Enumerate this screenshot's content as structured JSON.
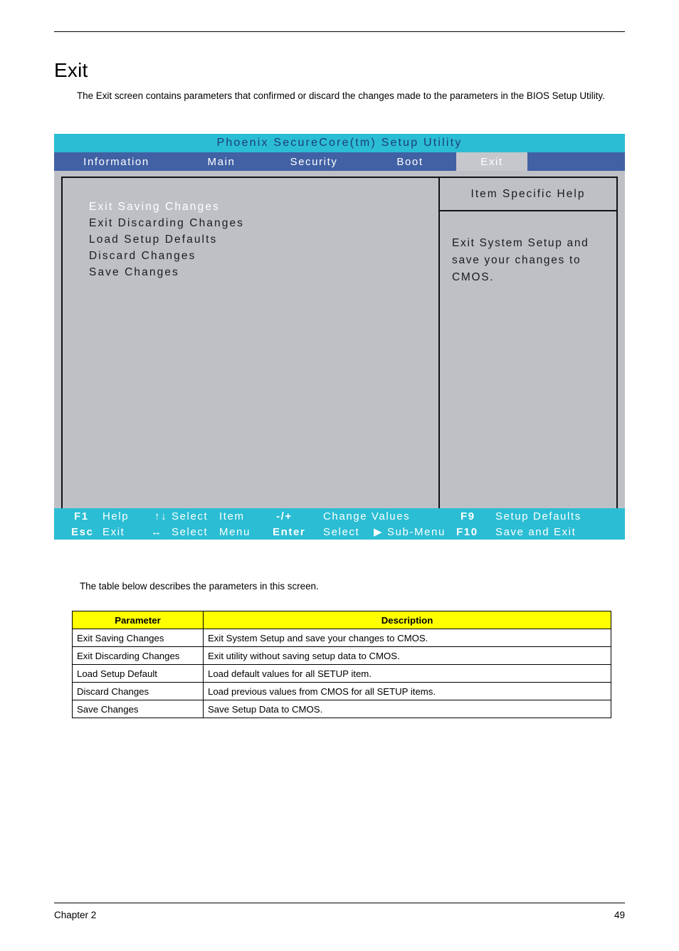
{
  "document": {
    "title": "Exit",
    "intro": "The Exit screen contains parameters that confirmed or discard the changes made to the parameters in the BIOS Setup Utility.",
    "table_lead": "The table below describes the parameters in this screen.",
    "footer_chapter": "Chapter 2",
    "footer_page": "49"
  },
  "bios": {
    "title": "Phoenix SecureCore(tm) Setup Utility",
    "tabs": [
      {
        "label": "Information",
        "active": false
      },
      {
        "label": "Main",
        "active": false
      },
      {
        "label": "Security",
        "active": false
      },
      {
        "label": "Boot",
        "active": false
      },
      {
        "label": "Exit",
        "active": true
      }
    ],
    "menu_items": [
      {
        "label": "Exit Saving Changes",
        "selected": true
      },
      {
        "label": "Exit Discarding Changes",
        "selected": false
      },
      {
        "label": "Load Setup Defaults",
        "selected": false
      },
      {
        "label": "Discard Changes",
        "selected": false
      },
      {
        "label": "Save Changes",
        "selected": false
      }
    ],
    "help": {
      "heading": "Item Specific Help",
      "line1": "Exit System Setup and",
      "line2": "save your changes to",
      "line3": "CMOS."
    },
    "keybar": {
      "f1_key": "F1",
      "f1_action": "Help",
      "updown_icon": "↑↓",
      "updown_action": "Select",
      "updown_target": "Item",
      "plusminus_key": "-/+",
      "plusminus_action": "Change Values",
      "f9_key": "F9",
      "f9_action": "Setup Defaults",
      "esc_key": "Esc",
      "esc_action": "Exit",
      "leftright_icon": "↔",
      "leftright_action": "Select",
      "leftright_target": "Menu",
      "enter_key": "Enter",
      "enter_action": "Select",
      "submenu_label": "▶ Sub-Menu",
      "f10_key": "F10",
      "f10_action": "Save and Exit"
    },
    "colors": {
      "title_bar": "#2bbdd3",
      "tab_bar": "#4161a4",
      "panel": "#bfc0c6",
      "active_tab": "#c6c7cc",
      "key_bar": "#2bbdd3",
      "title_text": "#1d3b80"
    }
  },
  "parameters_table": {
    "headers": [
      "Parameter",
      "Description"
    ],
    "header_bg": "#ffff00",
    "rows": [
      [
        "Exit Saving Changes",
        "Exit System Setup and save your changes to CMOS."
      ],
      [
        "Exit Discarding Changes",
        "Exit utility without saving setup data to CMOS."
      ],
      [
        "Load Setup Default",
        "Load default values for all SETUP item."
      ],
      [
        "Discard Changes",
        "Load previous values from CMOS for all SETUP items."
      ],
      [
        "Save Changes",
        "Save Setup Data to CMOS."
      ]
    ]
  }
}
